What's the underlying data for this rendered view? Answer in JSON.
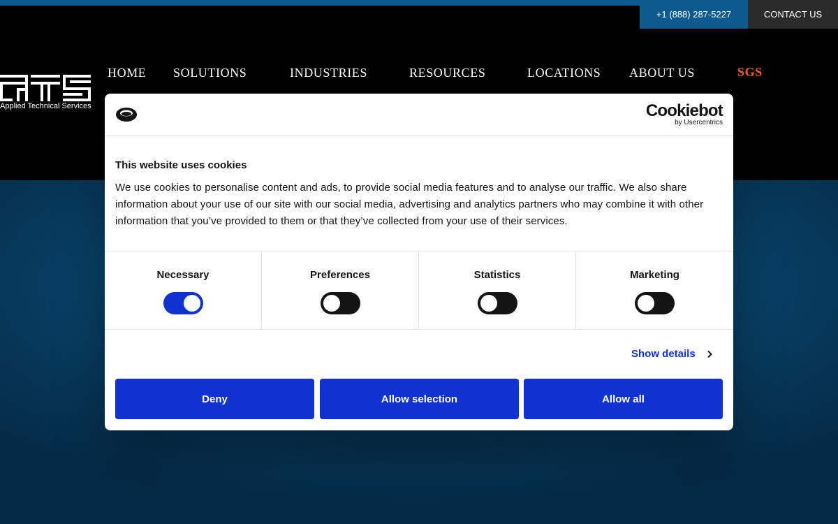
{
  "topbar": {
    "phone": "+1 (888) 287-5227",
    "contact": "CONTACT US"
  },
  "brand": {
    "tagline": "Applied Technical Services",
    "logo_icon": "ats-logo"
  },
  "nav": {
    "items": [
      "HOME",
      "SOLUTIONS",
      "INDUSTRIES",
      "RESOURCES",
      "LOCATIONS",
      "ABOUT US"
    ],
    "sgs": "SGS"
  },
  "cookie_dialog": {
    "brand_name": "Cookiebot",
    "brand_sub": "by Usercentrics",
    "title": "This website uses cookies",
    "body": "We use cookies to personalise content and ads, to provide social media features and to analyse our traffic. We also share information about your use of our site with our social media, advertising and analytics partners who may combine it with other information that you’ve provided to them or that they’ve collected from your use of their services.",
    "categories": [
      {
        "label": "Necessary",
        "enabled": true
      },
      {
        "label": "Preferences",
        "enabled": false
      },
      {
        "label": "Statistics",
        "enabled": false
      },
      {
        "label": "Marketing",
        "enabled": false
      }
    ],
    "show_details": "Show details",
    "buttons": {
      "deny": "Deny",
      "allow_selection": "Allow selection",
      "allow_all": "Allow all"
    }
  },
  "colors": {
    "accent_blue": "#1032cf",
    "header_blue": "#0c5a8e",
    "sgs_orange": "#e8622a"
  }
}
